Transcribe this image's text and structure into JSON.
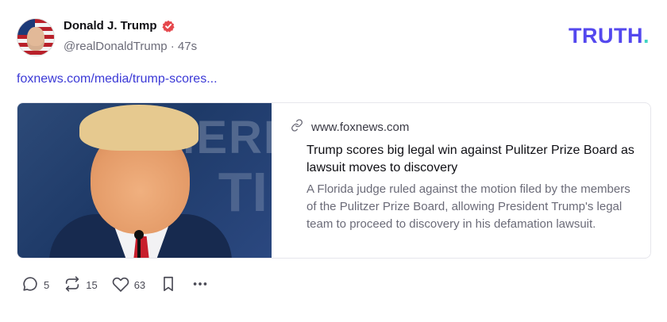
{
  "author": {
    "display_name": "Donald J. Trump",
    "handle": "@realDonaldTrump",
    "separator": "·",
    "time": "47s"
  },
  "brand": {
    "name": "TRUTH",
    "dot": "."
  },
  "post": {
    "link_text": "foxnews.com/media/trump-scores..."
  },
  "card": {
    "site": "www.foxnews.com",
    "title": "Trump scores big legal win against Pulitzer Prize Board as lawsuit moves to discovery",
    "description": "A Florida judge ruled against the motion filed by the members of the Pulitzer Prize Board, allowing President Trump's legal team to proceed to discovery in his defamation lawsuit.",
    "image_bg_text_1": "MERI",
    "image_bg_text_2": "TI"
  },
  "actions": {
    "replies": "5",
    "retruths": "15",
    "likes": "63"
  },
  "colors": {
    "brand": "#5448ee",
    "brand_dot": "#3fd4c3",
    "verified": "#e5484d",
    "link": "#3b39d6"
  },
  "icons": {
    "verified": "verified-badge-icon",
    "link": "link-icon",
    "reply": "reply-icon",
    "retruth": "retruth-icon",
    "like": "heart-icon",
    "bookmark": "bookmark-icon",
    "more": "more-icon"
  }
}
